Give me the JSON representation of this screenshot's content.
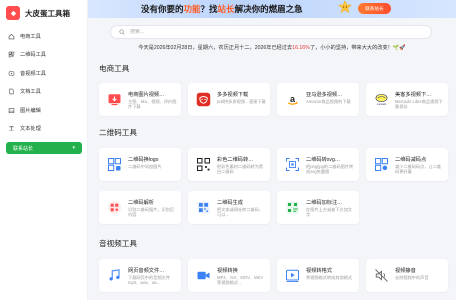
{
  "app": {
    "name": "大皮蛋工具箱"
  },
  "sidebar": {
    "items": [
      {
        "label": "电商工具",
        "icon": "home-icon"
      },
      {
        "label": "二维码工具",
        "icon": "qrcode-icon"
      },
      {
        "label": "音视频工具",
        "icon": "video-icon"
      },
      {
        "label": "文档工具",
        "icon": "document-icon"
      },
      {
        "label": "图片编辑",
        "icon": "image-icon"
      },
      {
        "label": "文本处理",
        "icon": "text-icon"
      }
    ],
    "contact_label": "联系站长",
    "contact_dropdown": "▾"
  },
  "banner": {
    "text_a": "没有你要的",
    "text_hl1": "功能",
    "text_b": "？找",
    "text_hl2": "站长",
    "text_c": "解决你的燃眉之急",
    "button_label": "联系站长"
  },
  "search": {
    "placeholder": "搜索..."
  },
  "greeting": {
    "before": "今天是2026年02月28日，星期六，农历正月十二，2026年已经过去",
    "percent": "16.16%",
    "after": "了，小小的坚持，带来大大的改变！🌱🚀"
  },
  "sections": [
    {
      "title": "电商工具",
      "cards": [
        {
          "title": "电商图片视频…",
          "desc": "主图、sku、视频、评价图片下载",
          "icon": "ecommerce-download-icon",
          "color": "#ff4d4f"
        },
        {
          "title": "多多视频下载",
          "desc": "pdd拼多多视频…直接下载",
          "icon": "pinduoduo-icon",
          "color": "#e02e24"
        },
        {
          "title": "亚马逊多视频…",
          "desc": "Amazon商品视频的下载",
          "icon": "amazon-icon",
          "color": "#222222"
        },
        {
          "title": "美客多视频下…",
          "desc": "Mercado Libre商品视频下载保存",
          "icon": "mercadolibre-icon",
          "color": "#2d3277"
        }
      ]
    },
    {
      "title": "二维码工具",
      "cards": [
        {
          "title": "二维码换logo",
          "desc": "二维码中间加图片",
          "icon": "qrcode-logo-icon",
          "color": "#3b82f6"
        },
        {
          "title": "彩色二维码转…",
          "desc": "把彩色素材二维码转为黑白二维码",
          "icon": "qrcode-color-icon",
          "color": "#222222"
        },
        {
          "title": "二维码转svg…",
          "desc": "把png/jpg的二维码图片转成svg矢量图",
          "icon": "qrcode-svg-icon",
          "color": "#3b82f6"
        },
        {
          "title": "二维码减码点",
          "desc": "减少二维码码点，让二维码更好看",
          "icon": "qrcode-reduce-icon",
          "color": "#3b82f6"
        },
        {
          "title": "二维码解析",
          "desc": "识别二维码图片，识别后内容",
          "icon": "qrcode-decode-icon",
          "color": "#ff4d4f"
        },
        {
          "title": "二维码生成",
          "desc": "把文本或网址转二维码，可以…",
          "icon": "qrcode-generate-icon",
          "color": "#3b82f6"
        },
        {
          "title": "二维码加标注…",
          "desc": "在图片上方或者下方加文字",
          "icon": "qrcode-label-icon",
          "color": "#22b14c"
        }
      ]
    },
    {
      "title": "音视频工具",
      "cards": [
        {
          "title": "网页音频文件…",
          "desc": "下载网页中的音频文件mp3、wav、aa…",
          "icon": "audio-download-icon",
          "color": "#3b82f6"
        },
        {
          "title": "视频转换",
          "desc": "MP4、AVI、MOV、MKV等视频格式…",
          "icon": "video-convert-icon",
          "color": "#3b82f6"
        },
        {
          "title": "视频转格式",
          "desc": "将视频格式转成其他格式",
          "icon": "video-format-icon",
          "color": "#3b82f6"
        },
        {
          "title": "视频静音",
          "desc": "去除视频中的声音",
          "icon": "video-mute-icon",
          "color": "#888888"
        }
      ]
    }
  ]
}
